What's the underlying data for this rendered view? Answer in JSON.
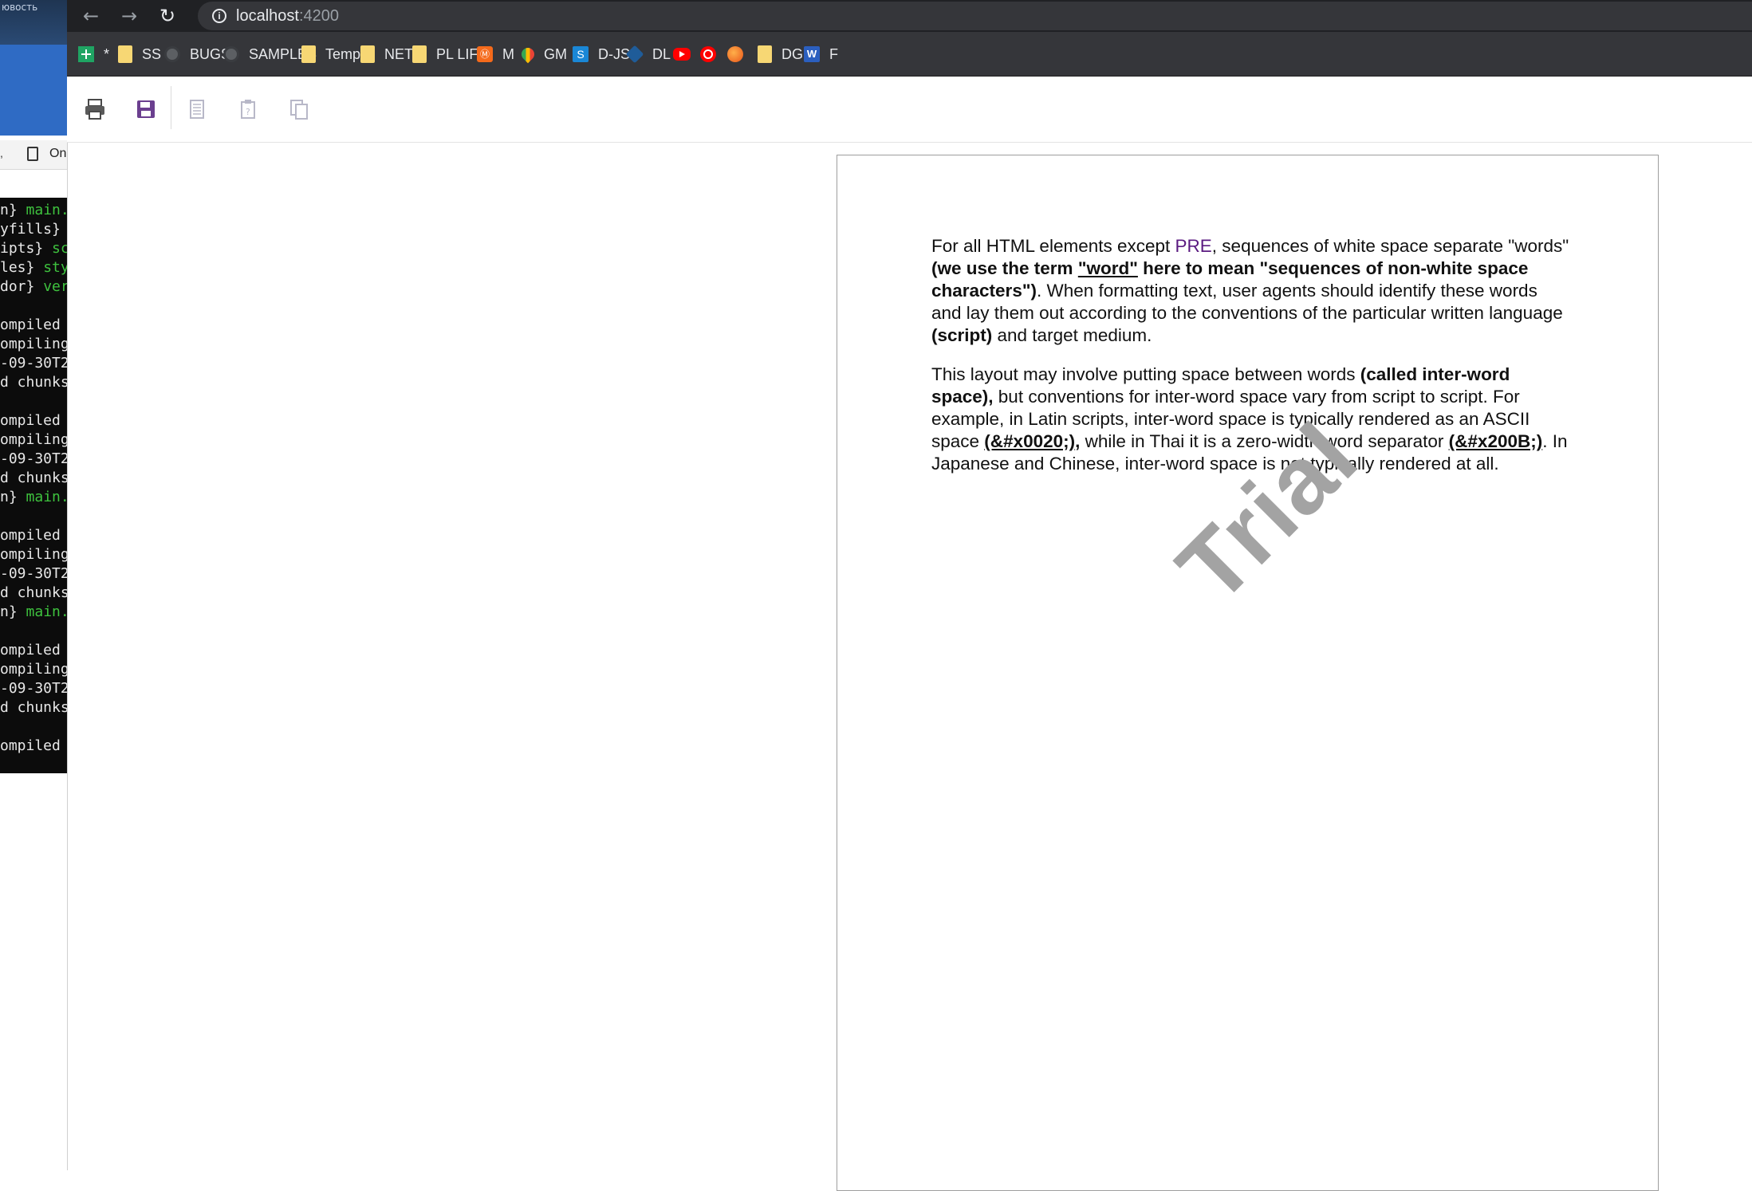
{
  "left_window": {
    "top_fragment": "ювость",
    "tab_fragment": ",",
    "tab_label": "On",
    "terminal_lines": [
      {
        "a": "n} ",
        "b": "main."
      },
      {
        "a": "yfills}",
        "b": ""
      },
      {
        "a": "ipts} ",
        "b": "sc"
      },
      {
        "a": "les} ",
        "b": "sty"
      },
      {
        "a": "dor} ",
        "b": "ver"
      },
      {
        "a": "",
        "b": ""
      },
      {
        "a": "ompiled",
        "b": ""
      },
      {
        "a": "ompiling",
        "b": ""
      },
      {
        "a": "-09-30T2",
        "b": ""
      },
      {
        "a": "d chunks",
        "b": ""
      },
      {
        "a": "",
        "b": ""
      },
      {
        "a": "ompiled",
        "b": ""
      },
      {
        "a": "ompiling",
        "b": ""
      },
      {
        "a": "-09-30T2",
        "b": ""
      },
      {
        "a": "d chunks",
        "b": ""
      },
      {
        "a": "n} ",
        "b": "main."
      },
      {
        "a": "",
        "b": ""
      },
      {
        "a": "ompiled",
        "b": ""
      },
      {
        "a": "ompiling",
        "b": ""
      },
      {
        "a": "-09-30T2",
        "b": ""
      },
      {
        "a": "d chunks",
        "b": ""
      },
      {
        "a": "n} ",
        "b": "main."
      },
      {
        "a": "",
        "b": ""
      },
      {
        "a": "ompiled",
        "b": ""
      },
      {
        "a": "ompiling",
        "b": ""
      },
      {
        "a": "-09-30T2",
        "b": ""
      },
      {
        "a": "d chunks",
        "b": ""
      },
      {
        "a": "",
        "b": ""
      },
      {
        "a": "ompiled",
        "b": ""
      }
    ]
  },
  "browser": {
    "url_host": "localhost",
    "url_port": ":4200",
    "bookmarks": [
      {
        "label": "*",
        "icon": "sheets-icon"
      },
      {
        "label": "SS",
        "icon": "folder-icon"
      },
      {
        "label": "BUGS",
        "icon": "github-icon"
      },
      {
        "label": "SAMPLES",
        "icon": "github-icon"
      },
      {
        "label": "Temp",
        "icon": "folder-icon"
      },
      {
        "label": "NET",
        "icon": "folder-icon"
      },
      {
        "label": "PL LIFE",
        "icon": "folder-icon"
      },
      {
        "label": "M",
        "icon": "m-icon"
      },
      {
        "label": "GM",
        "icon": "maps-icon"
      },
      {
        "label": "D-JS",
        "icon": "djs-icon"
      },
      {
        "label": "DL",
        "icon": "dl-icon"
      },
      {
        "label": "",
        "icon": "youtube-icon"
      },
      {
        "label": "",
        "icon": "youtube-music-icon"
      },
      {
        "label": "",
        "icon": "orange-icon"
      },
      {
        "label": "DG",
        "icon": "folder-icon"
      },
      {
        "label": "F",
        "icon": "word-icon"
      }
    ]
  },
  "toolbar": {
    "icons": [
      "print-icon",
      "save-icon",
      "page-icon",
      "clipboard-icon",
      "copy-icon"
    ]
  },
  "document": {
    "p1": {
      "t1": "For all HTML elements except ",
      "pre": "PRE",
      "t2": ", sequences of white space separate \"words\" ",
      "b1": "(we use the term ",
      "word": "\"word\"",
      "b2": " here to mean \"sequences of non-white space characters\")",
      "t3": ". When formatting text, user agents should identify these words and lay them out according to the conventions of the particular written language ",
      "b3": "(script)",
      "t4": " and target medium."
    },
    "p2": {
      "t1": "This layout may involve putting space between words ",
      "b1": "(called inter-word space),",
      "t2": " but conventions for inter-word space vary from script to script. For example, in Latin scripts, inter-word space is typically rendered as an ASCII space ",
      "b2u": "(&#x0020;)",
      "b2": ",",
      "t3": " while in Thai it is a zero-width word separator ",
      "b3u": "(&#x200B;)",
      "t4": ". In Japanese and Chinese, inter-word space is not typically rendered at all."
    },
    "watermark": "Trial"
  }
}
